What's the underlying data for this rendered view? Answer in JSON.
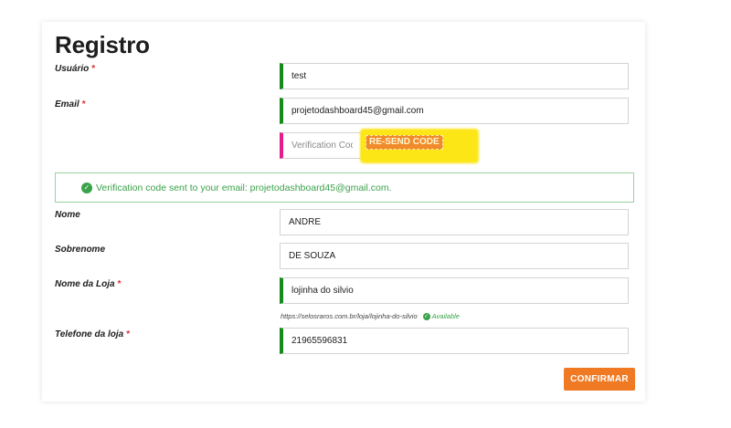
{
  "title": "Registro",
  "required_mark": "*",
  "fields": {
    "usuario": {
      "label": "Usuário",
      "value": "test"
    },
    "email": {
      "label": "Email",
      "value": "projetodashboard45@gmail.com"
    },
    "verification": {
      "placeholder": "Verification Code",
      "resend_label": "RE-SEND CODE"
    },
    "nome": {
      "label": "Nome",
      "value": "ANDRE"
    },
    "sobrenome": {
      "label": "Sobrenome",
      "value": "DE SOUZA"
    },
    "loja": {
      "label": "Nome da Loja",
      "value": "lojinha do silvio"
    },
    "telefone": {
      "label": "Telefone da loja",
      "value": "21965596831"
    }
  },
  "alert": {
    "message": "Verification code sent to your email: projetodashboard45@gmail.com.",
    "icon": "check-circle-icon",
    "color": "#3aa24a"
  },
  "store_url": {
    "url": "https://selosraros.com.br/loja/lojinha-do-silvio",
    "status": "Available"
  },
  "confirm_label": "CONFIRMAR",
  "colors": {
    "valid_border": "#178a1c",
    "pending_border": "#e51c8a",
    "button": "#f07a23",
    "highlight": "#fde616",
    "required": "#e02d2d"
  }
}
